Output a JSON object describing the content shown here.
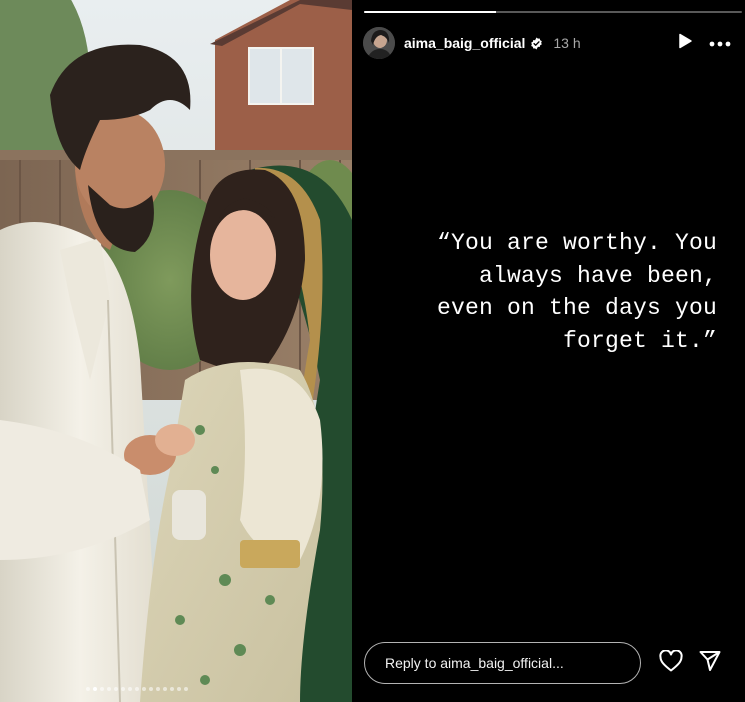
{
  "photo": {
    "carousel": {
      "count": 15,
      "active_index": 1
    }
  },
  "story": {
    "progress": {
      "segments": 1,
      "current_fraction": 0.35
    },
    "header": {
      "username": "aima_baig_official",
      "verified": true,
      "timestamp": "13 h",
      "icons": {
        "play": "play-icon",
        "more": "more-options-icon",
        "verified": "verified-badge-icon"
      }
    },
    "quote_text": "“You are worthy. You\nalways have been,\neven on the days you\nforget it.”",
    "reply": {
      "placeholder": "Reply to aima_baig_official...",
      "icons": {
        "like": "heart-icon",
        "share": "send-icon"
      }
    }
  },
  "colors": {
    "background": "#000000",
    "text": "#ffffff",
    "timestamp": "#a8a8a8",
    "verified_badge": "#0095f6"
  }
}
